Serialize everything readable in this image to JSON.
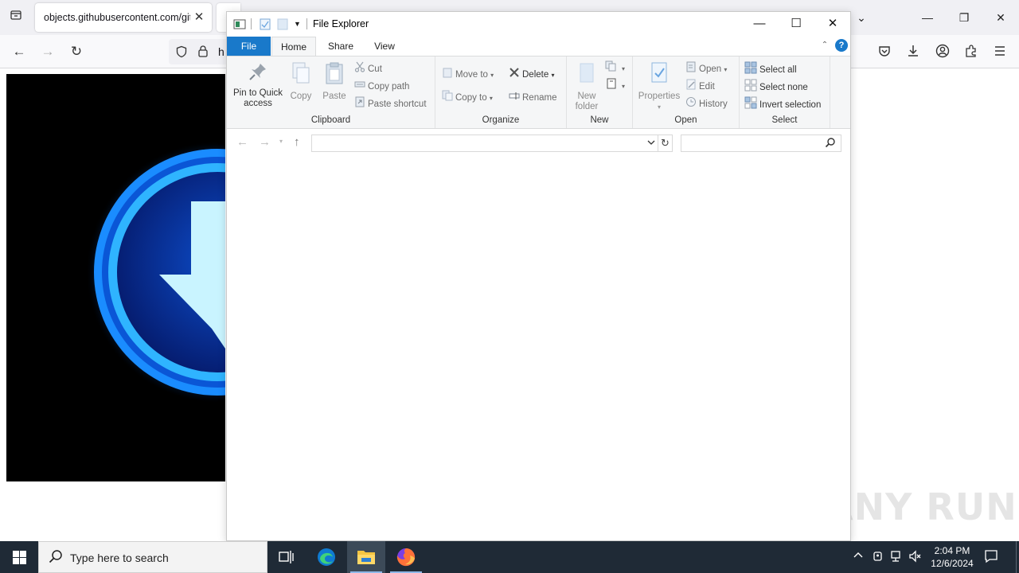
{
  "browser": {
    "tab_title": "objects.githubusercontent.com/gith",
    "tab_close_label": "✕",
    "url_text": "h",
    "window_controls": {
      "dropdown": "⌄",
      "minimize": "—",
      "restore": "❐",
      "close": "✕"
    },
    "nav": {
      "back": "←",
      "forward": "→",
      "reload": "↻"
    },
    "toolbar_icons": [
      "pocket-icon",
      "download-icon",
      "account-icon",
      "extensions-icon",
      "menu-icon"
    ]
  },
  "explorer": {
    "title": "File Explorer",
    "window_controls": {
      "minimize": "—",
      "maximize": "☐",
      "close": "✕"
    },
    "tabs": {
      "file": "File",
      "home": "Home",
      "share": "Share",
      "view": "View"
    },
    "help": "?",
    "clipboard": {
      "label": "Clipboard",
      "pin": "Pin to Quick access",
      "copy": "Copy",
      "paste": "Paste",
      "cut": "Cut",
      "copy_path": "Copy path",
      "paste_shortcut": "Paste shortcut"
    },
    "organize": {
      "label": "Organize",
      "move_to": "Move to",
      "copy_to": "Copy to",
      "delete": "Delete",
      "rename": "Rename"
    },
    "new": {
      "label": "New",
      "new_folder": "New folder"
    },
    "open": {
      "label": "Open",
      "properties": "Properties",
      "open": "Open",
      "edit": "Edit",
      "history": "History"
    },
    "select": {
      "label": "Select",
      "select_all": "Select all",
      "select_none": "Select none",
      "invert": "Invert selection"
    },
    "address_value": "",
    "search_value": ""
  },
  "watermark": "ANY RUN",
  "taskbar": {
    "search_placeholder": "Type here to search",
    "time": "2:04 PM",
    "date": "12/6/2024",
    "apps": [
      "task-view-icon",
      "edge-icon",
      "file-explorer-icon",
      "firefox-icon"
    ]
  }
}
